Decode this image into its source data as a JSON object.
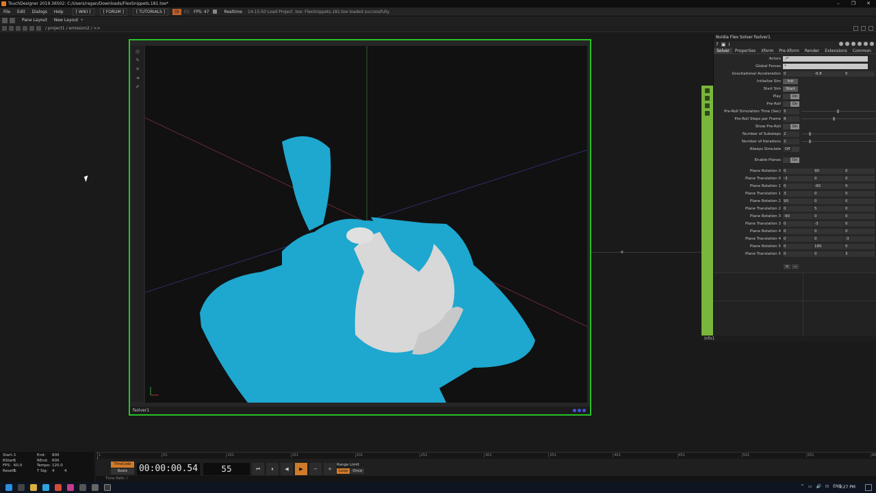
{
  "window": {
    "title": "TouchDesigner 2019.36502: C:/Users/ragan/Downloads/FlexSnippets.181.toe*",
    "controls": [
      "–",
      "❐",
      "✕"
    ]
  },
  "menubar": {
    "items": [
      "File",
      "Edit",
      "Dialogs",
      "Help"
    ],
    "wiki": "[ WIKI ]",
    "forum": "[ FORUM ]",
    "tutorials": "[ TUTORIALS ]",
    "mode": "OI",
    "mode_dim": "ED",
    "fps": "FPS: 47",
    "realtime": "Realtime",
    "log": "14:15:50 Load Project .toe: FlexSnippets.181.toe loaded successfully."
  },
  "panebar": {
    "pane_layout": "Pane Layout",
    "new_layout": "New Layout",
    "add": "+"
  },
  "pathbar": {
    "path": "/ project1 / emission2 / >>"
  },
  "viewer": {
    "node_name": "fsolver1"
  },
  "node_strip": {
    "label": "info1"
  },
  "param_panel": {
    "title": "Nvidia Flex Solver  fsolver1",
    "tabs": [
      "Solver",
      "Properties",
      "Xform",
      "Pre-Xform",
      "Render",
      "Extensions",
      "Common"
    ],
    "active_tab": "Solver",
    "rows": {
      "actors": {
        "label": "Actors",
        "value": "./*"
      },
      "global_forces": {
        "label": "Global Forces",
        "value": "*"
      },
      "grav": {
        "label": "Gravitational Acceleration",
        "v0": "0",
        "v1": "-9.8",
        "v2": "0"
      },
      "init_sim": {
        "label": "Initialize Sim",
        "btn": "Init"
      },
      "start_sim": {
        "label": "Start Sim",
        "btn": "Start"
      },
      "play": {
        "label": "Play",
        "state": "On"
      },
      "preroll": {
        "label": "Pre-Roll",
        "state": "On"
      },
      "preroll_time": {
        "label": "Pre-Roll Simulation Time (Sec)",
        "value": "5"
      },
      "preroll_steps": {
        "label": "Pre-Roll Steps per Frame",
        "value": "8"
      },
      "show_preroll": {
        "label": "Show Pre-Roll",
        "state": "On"
      },
      "substeps": {
        "label": "Number of Substeps",
        "value": "2"
      },
      "iterations": {
        "label": "Number of Iterations",
        "value": "2"
      },
      "always_sim": {
        "label": "Always Simulate",
        "state": "Off"
      },
      "enable_planes": {
        "label": "Enable Planes",
        "state": "On"
      },
      "planes": [
        {
          "label": "Plane Rotation 0",
          "v0": "0",
          "v1": "90",
          "v2": "0"
        },
        {
          "label": "Plane Translation 0",
          "v0": "-3",
          "v1": "0",
          "v2": "0"
        },
        {
          "label": "Plane Rotation 1",
          "v0": "0",
          "v1": "-90",
          "v2": "0"
        },
        {
          "label": "Plane Translation 1",
          "v0": "3",
          "v1": "0",
          "v2": "0"
        },
        {
          "label": "Plane Rotation 2",
          "v0": "90",
          "v1": "0",
          "v2": "0"
        },
        {
          "label": "Plane Translation 2",
          "v0": "0",
          "v1": "5",
          "v2": "0"
        },
        {
          "label": "Plane Rotation 3",
          "v0": "-90",
          "v1": "0",
          "v2": "0"
        },
        {
          "label": "Plane Translation 3",
          "v0": "0",
          "v1": "-3",
          "v2": "0"
        },
        {
          "label": "Plane Rotation 4",
          "v0": "0",
          "v1": "0",
          "v2": "0"
        },
        {
          "label": "Plane Translation 4",
          "v0": "0",
          "v1": "0",
          "v2": "-3"
        },
        {
          "label": "Plane Rotation 5",
          "v0": "0",
          "v1": "180",
          "v2": "0"
        },
        {
          "label": "Plane Translation 5",
          "v0": "0",
          "v1": "0",
          "v2": "3"
        }
      ]
    }
  },
  "bottom_info": {
    "start_l": "Start:",
    "start_v": "1",
    "end_l": "End:",
    "end_v": "600",
    "rstart_l": "RStart:",
    "rstart_v": "1",
    "rend_l": "REnd:",
    "rend_v": "600",
    "fps_l": "FPS:",
    "fps_v": "60.0",
    "tempo_l": "Tempo:",
    "tempo_v": "120.0",
    "resetf_l": "ResetF:",
    "resetf_v": "1",
    "tsig_l": "T Sig:",
    "tsig_v1": "4",
    "tsig_v2": "4"
  },
  "timeline": {
    "ticks": [
      "1",
      "51",
      "101",
      "151",
      "201",
      "251",
      "301",
      "351",
      "401",
      "451",
      "501",
      "551",
      "600"
    ]
  },
  "transport": {
    "timecode_label": "TimeCode",
    "beats_label": "Beats",
    "timecode": "00:00:00.54",
    "frame": "55",
    "buttons": [
      "⏮",
      "⏸",
      "◀",
      "▶",
      "−",
      "+"
    ],
    "range_limit": "Range Limit",
    "loop": "Loop",
    "once": "Once",
    "time_path": "Time Path: /"
  },
  "taskbar": {
    "tray": [
      "^",
      "▭",
      "🔊",
      "⊡",
      "ENG"
    ],
    "clock": "3:27 PM"
  }
}
